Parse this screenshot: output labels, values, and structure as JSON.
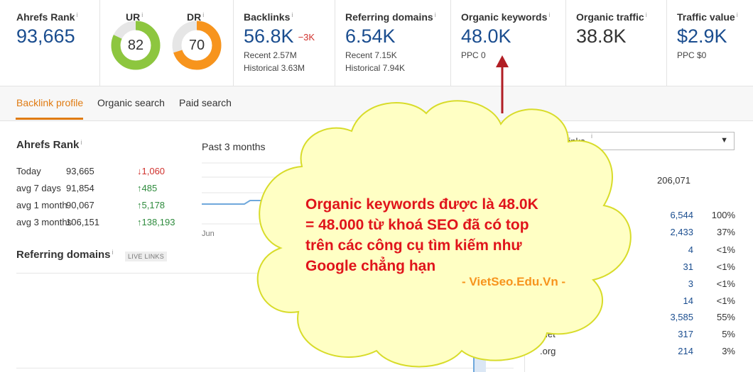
{
  "metrics": {
    "ahrefs_rank": {
      "title": "Ahrefs Rank",
      "value": "93,665"
    },
    "ur": {
      "title": "UR",
      "value": "82",
      "level_percent": 82,
      "color": "#8dc63f"
    },
    "dr": {
      "title": "DR",
      "value": "70",
      "level_percent": 70,
      "color": "#f7941d"
    },
    "backlinks": {
      "title": "Backlinks",
      "value": "56.8K",
      "delta": "−3K",
      "recent": "Recent 2.57M",
      "historical": "Historical 3.63M"
    },
    "referring_domains": {
      "title": "Referring domains",
      "value": "6.54K",
      "recent": "Recent 7.15K",
      "historical": "Historical 7.94K"
    },
    "organic_keywords": {
      "title": "Organic keywords",
      "value": "48.0K",
      "ppc": "PPC 0"
    },
    "organic_traffic": {
      "title": "Organic traffic",
      "value": "38.8K"
    },
    "traffic_value": {
      "title": "Traffic value",
      "value": "$2.9K",
      "ppc": "PPC $0"
    }
  },
  "info_glyph": "i",
  "tabs": [
    {
      "label": "Backlink profile",
      "active": true
    },
    {
      "label": "Organic search",
      "active": false
    },
    {
      "label": "Paid search",
      "active": false
    }
  ],
  "rank_section": {
    "title": "Ahrefs Rank",
    "period": "Past 3 months",
    "chart_tick": "Jun",
    "rows": [
      {
        "label": "Today",
        "value": "93,665",
        "change": "↓1,060",
        "dir": "down"
      },
      {
        "label": "avg 7 days",
        "value": "91,854",
        "change": "↑485",
        "dir": "up"
      },
      {
        "label": "avg 1 month",
        "value": "90,067",
        "change": "↑5,178",
        "dir": "up"
      },
      {
        "label": "avg 3 months",
        "value": "106,151",
        "change": "↑138,193",
        "dir": "up"
      }
    ]
  },
  "referring_section": {
    "title": "Referring domains",
    "badge": "LIVE LINKS"
  },
  "right_panel": {
    "select_value": "Live links",
    "header_label_fragment": "es",
    "header_total": "206,071",
    "rows": [
      {
        "label": "",
        "count": "6,544",
        "percent": "100%"
      },
      {
        "label": "",
        "count": "2,433",
        "percent": "37%"
      },
      {
        "label": "",
        "count": "4",
        "percent": "<1%"
      },
      {
        "label": "",
        "count": "31",
        "percent": "<1%"
      },
      {
        "label": "",
        "count": "3",
        "percent": "<1%"
      },
      {
        "label": "",
        "count": "14",
        "percent": "<1%"
      },
      {
        "label": "",
        "count": "3,585",
        "percent": "55%"
      },
      {
        "label": ".net",
        "count": "317",
        "percent": "5%"
      },
      {
        "label": ".org",
        "count": "214",
        "percent": "3%"
      }
    ]
  },
  "annotation": {
    "line1": "Organic keywords được là 48.0K",
    "line2": "= 48.000 từ khoá SEO đã có top",
    "line3": "trên các công cụ tìm kiếm như",
    "line4": "Google chẳng hạn",
    "credit": "- VietSeo.Edu.Vn -",
    "text_color": "#e0141b",
    "credit_color": "#f7941d",
    "cloud_fill": "#ffffc4",
    "cloud_stroke": "#d8dc2a",
    "arrow_color": "#b11e24"
  },
  "colors": {
    "accent": "#e07b12",
    "link": "#1a4d8f",
    "up": "#2e8b3d",
    "down": "#d0312d"
  }
}
